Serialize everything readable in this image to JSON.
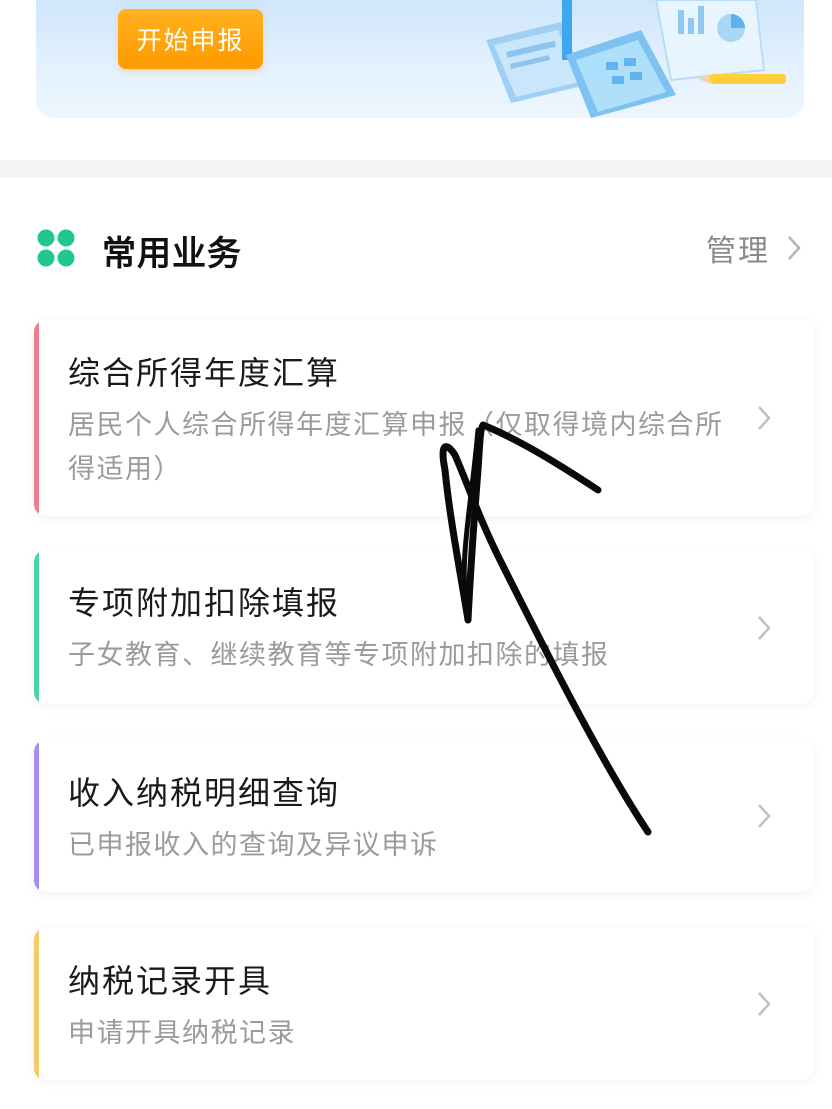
{
  "banner": {
    "start_button": "开始申报"
  },
  "section": {
    "title": "常用业务",
    "manage_label": "管理"
  },
  "services": [
    {
      "title": "综合所得年度汇算",
      "description": "居民个人综合所得年度汇算申报（仅取得境内综合所得适用）",
      "accent": "#f07b8c"
    },
    {
      "title": "专项附加扣除填报",
      "description": "子女教育、继续教育等专项附加扣除的填报",
      "accent": "#49d3a4"
    },
    {
      "title": "收入纳税明细查询",
      "description": "已申报收入的查询及异议申诉",
      "accent": "#a58cf0"
    },
    {
      "title": "纳税记录开具",
      "description": "申请开具纳税记录",
      "accent": "#f6c96a"
    }
  ],
  "icons": {
    "section": "four-dots-grid-icon",
    "chevron": "chevron-right-icon",
    "illustration": "document-charts-illustration"
  },
  "colors": {
    "brand_green": "#22c78a",
    "button_orange": "#ff9f0a",
    "banner_blue": "#d6ebfc"
  }
}
